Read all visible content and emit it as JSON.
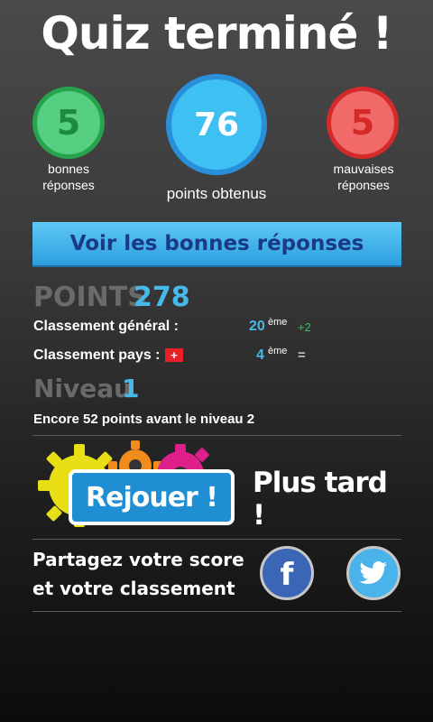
{
  "header": {
    "title": "Quiz terminé !"
  },
  "stats": {
    "correct": {
      "value": "5",
      "label_line1": "bonnes",
      "label_line2": "réponses",
      "color": "#27a34e"
    },
    "points": {
      "value": "76",
      "label": "points obtenus",
      "color": "#3ec0f2"
    },
    "wrong": {
      "value": "5",
      "label_line1": "mauvaises",
      "label_line2": "réponses",
      "color": "#d42a2a"
    }
  },
  "answers_button": {
    "label": "Voir les bonnes réponses"
  },
  "score": {
    "points_label": "POINTS",
    "points_value": "278",
    "general_rank_label": "Classement général :",
    "general_rank_value": "20",
    "general_rank_suffix": "ème",
    "general_rank_change": "+2",
    "country_rank_label": "Classement pays :",
    "country_flag": "switzerland-flag-icon",
    "country_rank_value": "4",
    "country_rank_suffix": "ème",
    "country_rank_change": "="
  },
  "level": {
    "label": "Niveau",
    "value": "1",
    "info": "Encore 52 points avant le niveau 2"
  },
  "actions": {
    "replay_label": "Rejouer !",
    "later_label": "Plus tard !"
  },
  "share": {
    "line1": "Partagez votre score",
    "line2": "et votre classement",
    "facebook_icon": "facebook-icon",
    "twitter_icon": "twitter-icon"
  },
  "colors": {
    "accent": "#47b8ea",
    "muted": "#6a6a6a",
    "button_blue": "#1f8ed2"
  }
}
